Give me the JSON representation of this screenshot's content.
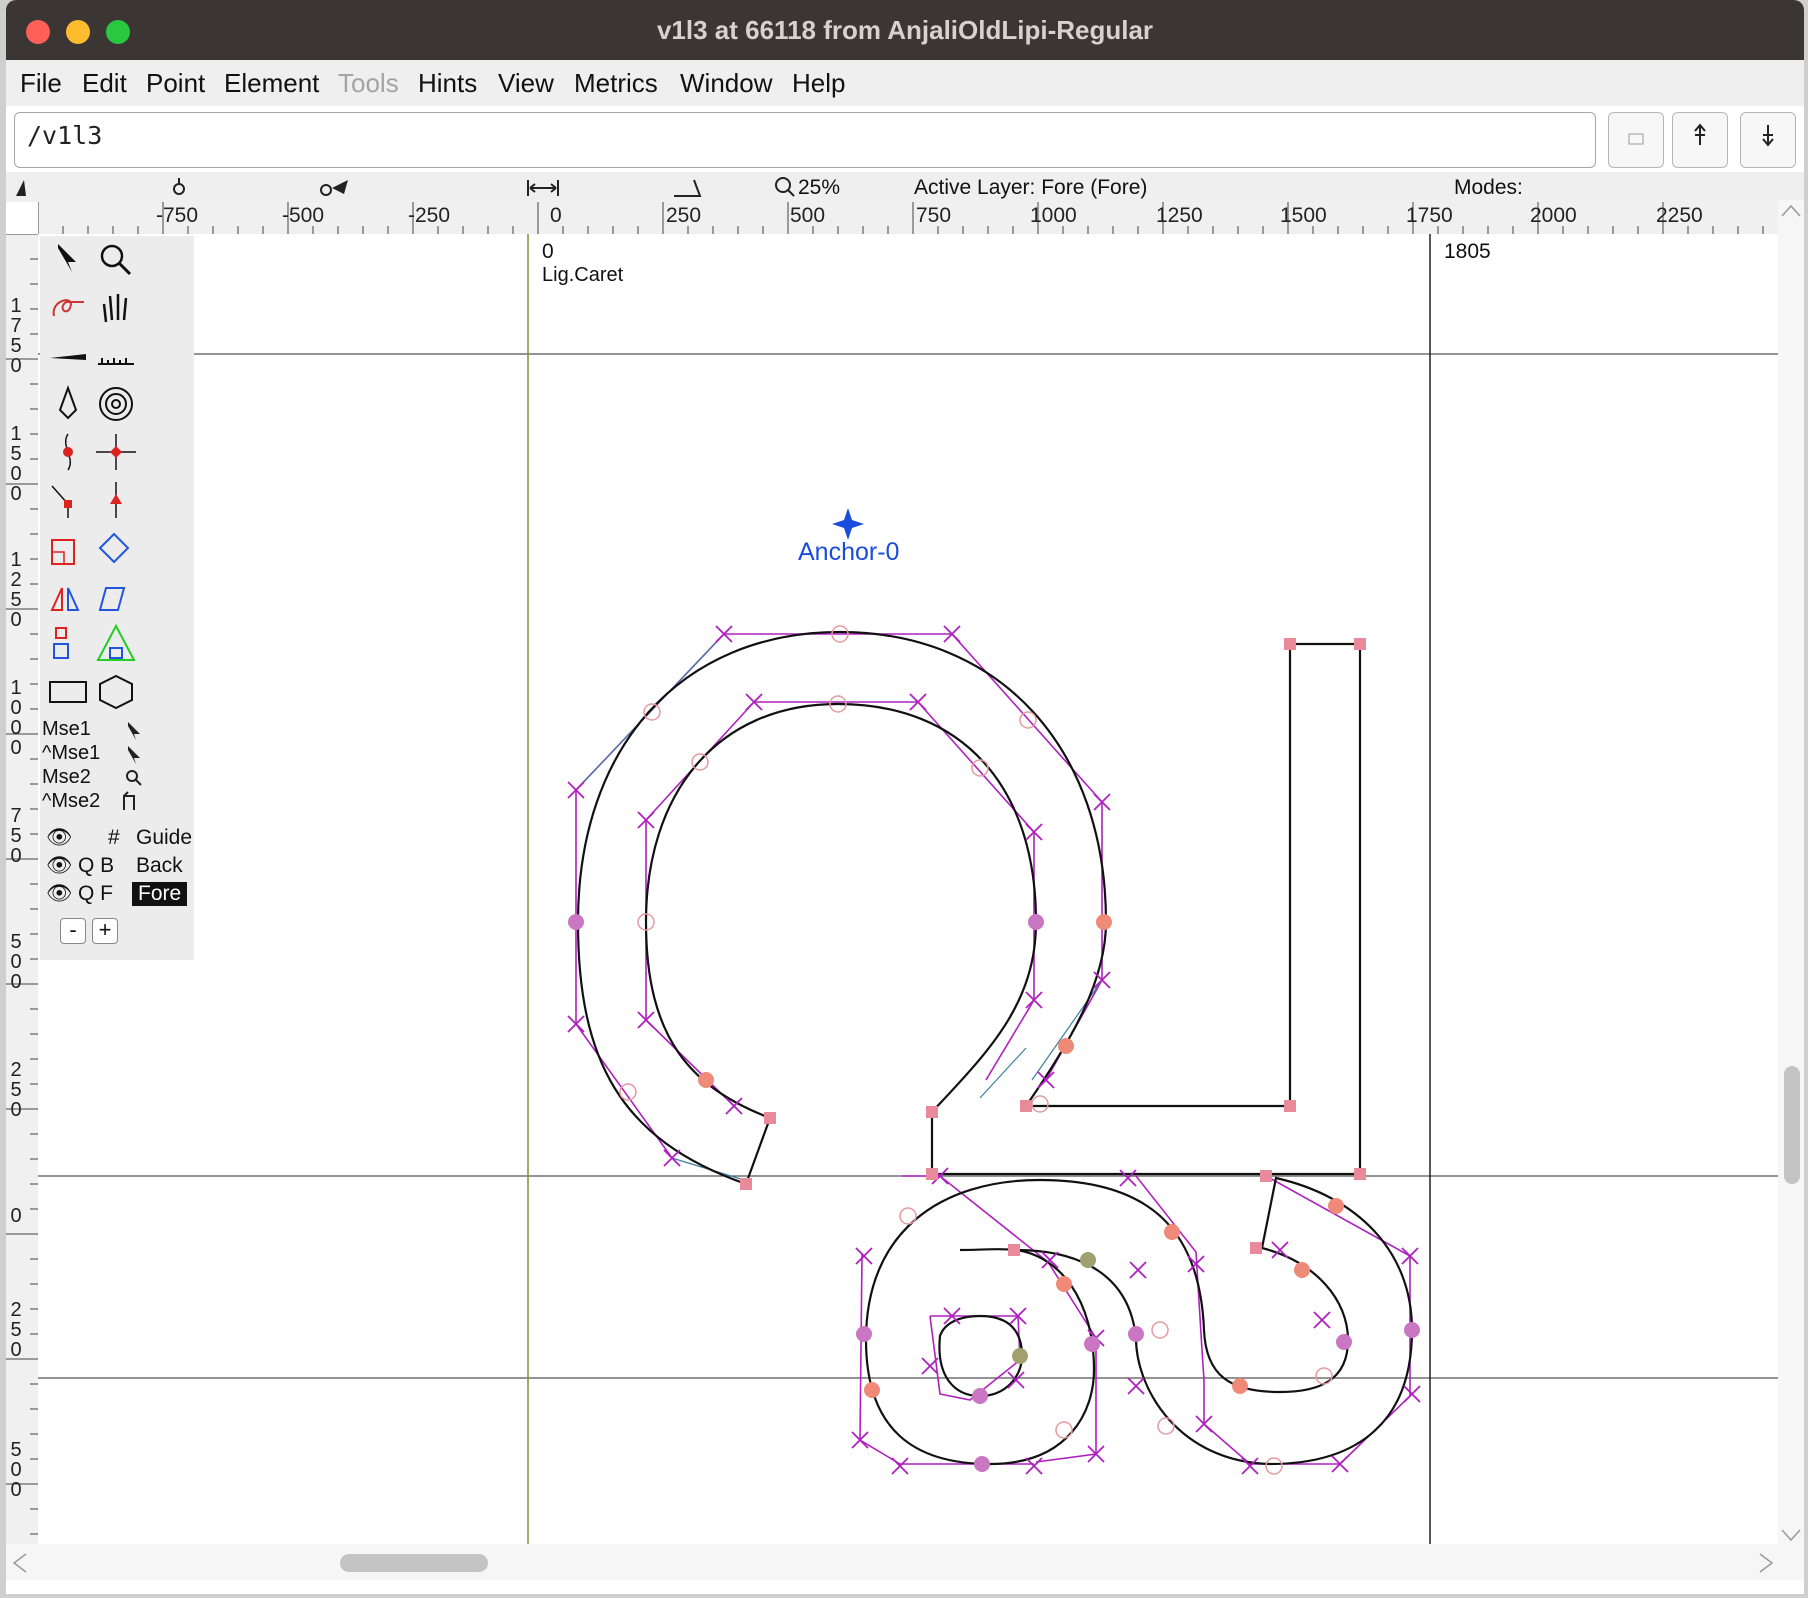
{
  "window": {
    "title": "v1l3 at 66118 from AnjaliOldLipi-Regular"
  },
  "menu": {
    "items": [
      {
        "label": "File",
        "enabled": true
      },
      {
        "label": "Edit",
        "enabled": true
      },
      {
        "label": "Point",
        "enabled": true
      },
      {
        "label": "Element",
        "enabled": true
      },
      {
        "label": "Tools",
        "enabled": false
      },
      {
        "label": "Hints",
        "enabled": true
      },
      {
        "label": "View",
        "enabled": true
      },
      {
        "label": "Metrics",
        "enabled": true
      },
      {
        "label": "Window",
        "enabled": true
      },
      {
        "label": "Help",
        "enabled": true
      }
    ]
  },
  "glyph_field": {
    "value": "/v1l3"
  },
  "nav_buttons": [
    {
      "icon": "blank-square-icon"
    },
    {
      "icon": "previous-glyph-icon"
    },
    {
      "icon": "next-glyph-icon"
    }
  ],
  "info_bar": {
    "zoom": "25%",
    "active_layer": "Active Layer: Fore (Fore)",
    "modes": "Modes:"
  },
  "ruler": {
    "h_labels": [
      "-750",
      "-500",
      "-250",
      "0",
      "250",
      "500",
      "750",
      "1000",
      "1250",
      "1500",
      "1750",
      "2000",
      "2250"
    ],
    "v_labels": [
      "1750",
      "1500",
      "1250",
      "1000",
      "750",
      "500",
      "250",
      "0",
      "250",
      "500"
    ]
  },
  "canvas": {
    "origin_label": "0",
    "lig_caret_label": "Lig.Caret",
    "advance_width_label": "1805",
    "anchor_label": "Anchor-0"
  },
  "toolbox": {
    "tools": [
      "pointer-icon",
      "magnify-icon",
      "freehand-icon",
      "hand-icon",
      "knife-icon",
      "ruler-icon",
      "pen-icon",
      "spiro-icon",
      "curve-point-icon",
      "hvcurve-point-icon",
      "corner-point-icon",
      "tangent-point-icon",
      "scale-icon",
      "rotate-icon",
      "flip-icon",
      "skew-icon",
      "3d-rotate-icon",
      "perspective-icon",
      "rectangle-icon",
      "polygon-icon"
    ],
    "mouse_labels": [
      "Mse1",
      "^Mse1",
      "Mse2",
      "^Mse2"
    ]
  },
  "layers": [
    {
      "mark": "#",
      "name": "Guide",
      "active": false
    },
    {
      "mark": "Q B",
      "name": "Back",
      "active": false
    },
    {
      "mark": "Q F",
      "name": "Fore",
      "active": true
    }
  ],
  "layer_buttons": {
    "remove": "-",
    "add": "+"
  },
  "colors": {
    "titlebar": "#3b3634",
    "outline": "#111111",
    "control_line": "#b020c0",
    "anchor": "#1a4ddc",
    "baseline_guide": "#8a8a3a"
  }
}
